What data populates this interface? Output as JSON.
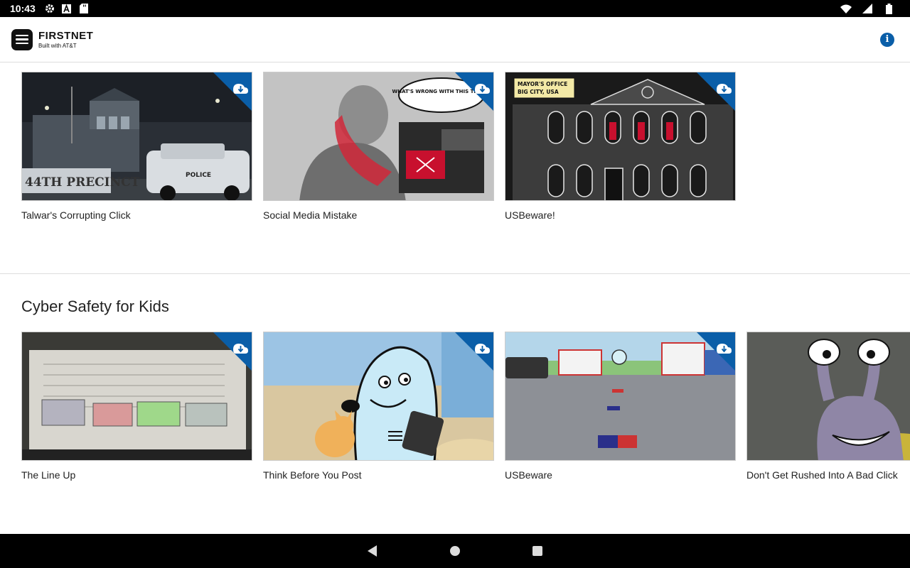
{
  "status_bar": {
    "time": "10:43",
    "icons": [
      "gear-icon",
      "a-icon",
      "sd-card-icon",
      "wifi-icon",
      "signal-icon",
      "battery-icon"
    ]
  },
  "app_bar": {
    "brand_name": "FIRSTNET",
    "brand_sub": "Built with AT&T",
    "info_label": "i"
  },
  "sections": [
    {
      "title": "",
      "items": [
        {
          "title": "Talwar's Corrupting Click",
          "downloadable": true
        },
        {
          "title": "Social Media Mistake",
          "downloadable": true
        },
        {
          "title": "USBeware!",
          "downloadable": true
        }
      ]
    },
    {
      "title": "Cyber Safety for Kids",
      "items": [
        {
          "title": "The Line Up",
          "downloadable": true
        },
        {
          "title": "Think Before You Post",
          "downloadable": true
        },
        {
          "title": "USBeware",
          "downloadable": true
        },
        {
          "title": "Don't Get Rushed Into A Bad Click",
          "downloadable": false
        }
      ]
    }
  ],
  "thumbnail_text": {
    "precinct": "44TH PRECINCT",
    "police": "POLICE",
    "speech": "WHAT'S WRONG WITH THIS THING?",
    "mayor_line1": "MAYOR'S OFFICE",
    "mayor_line2": "BIG CITY, USA"
  },
  "colors": {
    "accent": "#0a5ea8",
    "status_bar": "#000000",
    "nav_bar": "#000000"
  },
  "nav": {
    "buttons": [
      "back-icon",
      "home-icon",
      "recents-icon"
    ]
  }
}
